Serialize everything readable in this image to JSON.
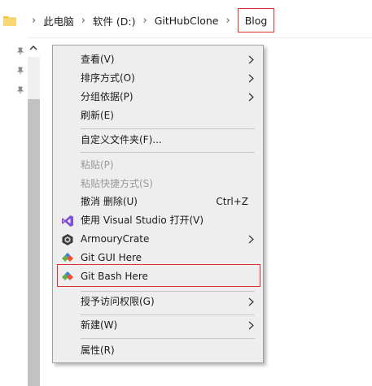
{
  "breadcrumb": {
    "items": [
      "此电脑",
      "软件 (D:)",
      "GitHubClone"
    ],
    "current": "Blog"
  },
  "context_menu": {
    "items": [
      {
        "label": "查看(V)",
        "submenu": true
      },
      {
        "label": "排序方式(O)",
        "submenu": true
      },
      {
        "label": "分组依据(P)",
        "submenu": true
      },
      {
        "label": "刷新(E)"
      },
      {
        "label": "自定义文件夹(F)..."
      },
      {
        "label": "粘贴(P)",
        "disabled": true
      },
      {
        "label": "粘贴快捷方式(S)",
        "disabled": true
      },
      {
        "label": "撤消 删除(U)",
        "shortcut": "Ctrl+Z"
      },
      {
        "label": "使用 Visual Studio 打开(V)",
        "icon": "visual-studio-icon"
      },
      {
        "label": "ArmouryCrate",
        "icon": "armoury-crate-icon",
        "submenu": true
      },
      {
        "label": "Git GUI Here",
        "icon": "git-icon"
      },
      {
        "label": "Git Bash Here",
        "icon": "git-icon",
        "highlighted": true
      },
      {
        "label": "授予访问权限(G)",
        "submenu": true
      },
      {
        "label": "新建(W)",
        "submenu": true
      },
      {
        "label": "属性(R)"
      }
    ]
  },
  "colors": {
    "highlight_border": "#d9342b",
    "menu_background": "#eeeeee",
    "disabled_text": "#9a9a9a",
    "visual_studio": "#7f4fd0",
    "git": "#f05133"
  }
}
